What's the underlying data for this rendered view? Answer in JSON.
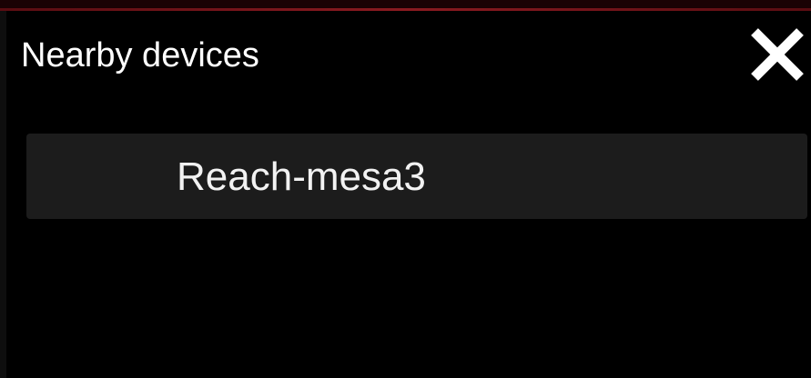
{
  "dialog": {
    "title": "Nearby devices",
    "close_icon": "close-icon",
    "devices": [
      {
        "label": "Reach-mesa3"
      }
    ]
  },
  "colors": {
    "background": "#000000",
    "item_background": "#1c1c1c",
    "text": "#ffffff",
    "top_accent": "#8a1a20"
  }
}
